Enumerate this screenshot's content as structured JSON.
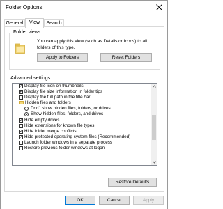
{
  "window": {
    "title": "Folder Options"
  },
  "tabs": [
    {
      "label": "General"
    },
    {
      "label": "View"
    },
    {
      "label": "Search"
    }
  ],
  "folder_views": {
    "title": "Folder views",
    "description": "You can apply this view (such as Details or Icons) to all folders of this type.",
    "apply_label": "Apply to Folders",
    "reset_label": "Reset Folders"
  },
  "advanced": {
    "label": "Advanced settings:",
    "items": [
      {
        "type": "checkbox",
        "checked": true,
        "label": "Display file icon on thumbnails"
      },
      {
        "type": "checkbox",
        "checked": true,
        "label": "Display file size information in folder tips"
      },
      {
        "type": "checkbox",
        "checked": false,
        "label": "Display the full path in the title bar"
      },
      {
        "type": "folder",
        "label": "Hidden files and folders"
      },
      {
        "type": "radio",
        "checked": false,
        "label": "Don't show hidden files, folders, or drives"
      },
      {
        "type": "radio",
        "checked": true,
        "label": "Show hidden files, folders, and drives"
      },
      {
        "type": "checkbox",
        "checked": true,
        "label": "Hide empty drives"
      },
      {
        "type": "checkbox",
        "checked": false,
        "label": "Hide extensions for known file types"
      },
      {
        "type": "checkbox",
        "checked": true,
        "label": "Hide folder merge conflicts"
      },
      {
        "type": "checkbox",
        "checked": true,
        "label": "Hide protected operating system files (Recommended)"
      },
      {
        "type": "checkbox",
        "checked": false,
        "label": "Launch folder windows in a separate process"
      },
      {
        "type": "checkbox",
        "checked": false,
        "label": "Restore previous folder windows at logon"
      }
    ],
    "restore_defaults_label": "Restore Defaults"
  },
  "footer": {
    "ok_label": "OK",
    "cancel_label": "Cancel",
    "apply_label": "Apply"
  },
  "icons": {
    "close": "close-icon",
    "folder": "folder-icon",
    "scroll_up": "chevron-up-icon",
    "scroll_down": "chevron-down-icon"
  },
  "colors": {
    "button_face": "#e1e1e1",
    "button_border": "#adadad",
    "primary_border": "#0078d7",
    "folder_yellow": "#f3d77a"
  }
}
